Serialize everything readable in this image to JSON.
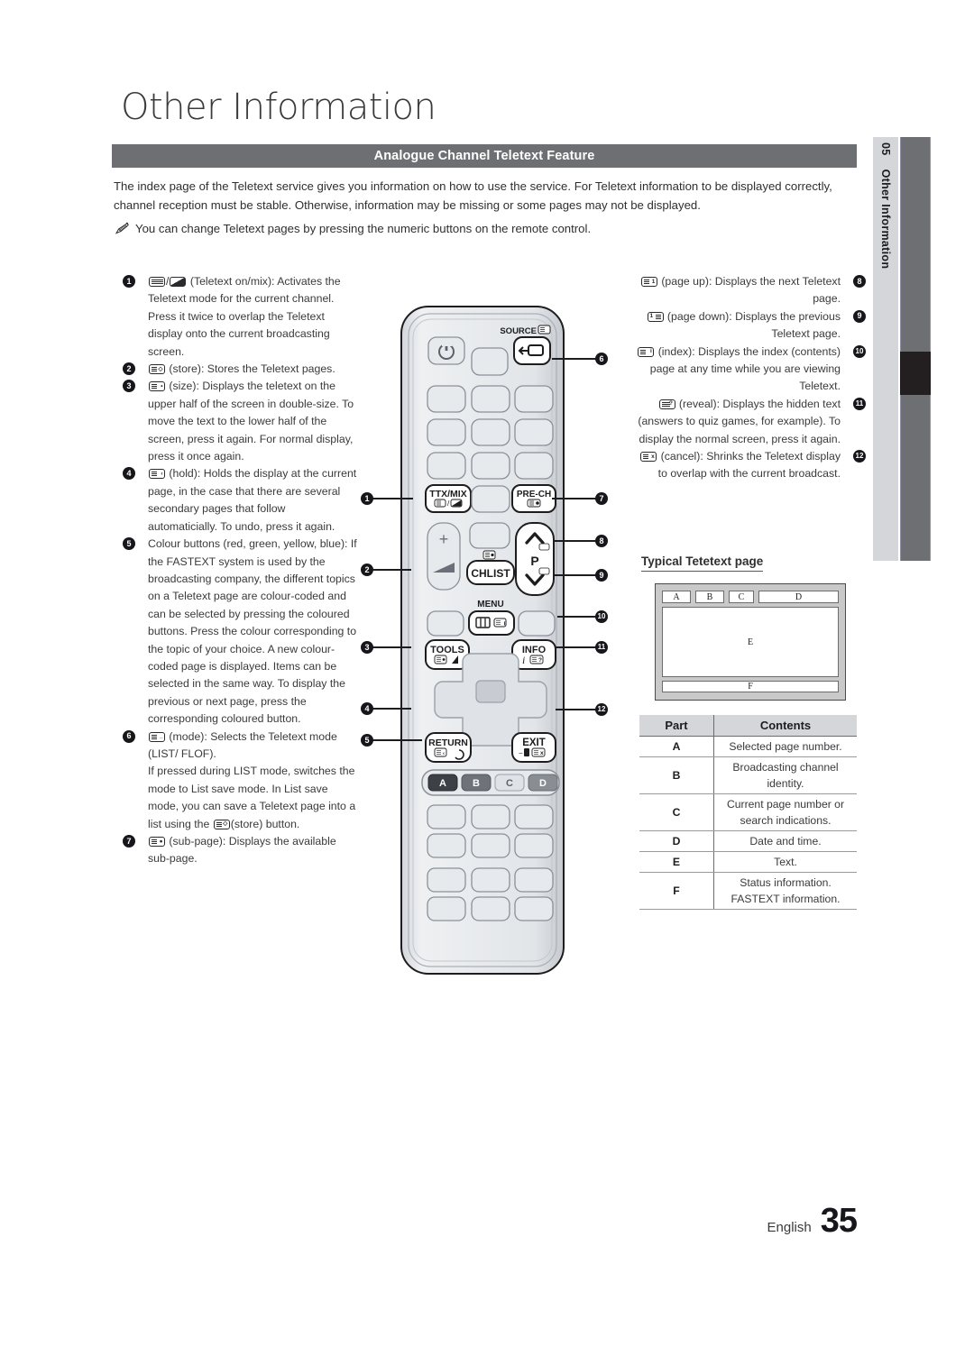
{
  "page_title": "Other Information",
  "section_header": "Analogue Channel Teletext Feature",
  "intro_paragraph": "The index page of the Teletext service gives you information on how to use the service. For Teletext information to be displayed correctly, channel reception must be stable. Otherwise, information may be missing or some pages may not be displayed.",
  "note": "You can change Teletext pages by pressing the numeric buttons on the remote control.",
  "note_icon": "pencil-icon",
  "sidebar": {
    "chapter_number": "05",
    "chapter_title": "Other Information"
  },
  "left_column": [
    {
      "number": "1",
      "icon": "teletext-on-mix-icon",
      "text": "(Teletext on/mix): Activates the Teletext mode for the current channel. Press it twice to overlap the Teletext display onto the current broadcasting screen."
    },
    {
      "number": "2",
      "icon": "teletext-store-icon",
      "text": "(store): Stores the Teletext pages."
    },
    {
      "number": "3",
      "icon": "teletext-size-icon",
      "text": "(size): Displays the teletext on the upper half of the screen in double-size. To move the text to the lower half of the screen, press it again. For normal display, press it once again."
    },
    {
      "number": "4",
      "icon": "teletext-hold-icon",
      "text": "(hold): Holds the display at the current page, in the case that there are several secondary pages that follow automaticially. To undo, press it again."
    },
    {
      "number": "5",
      "icon": "",
      "text": "Colour buttons (red, green, yellow, blue): If the FASTEXT system is used by the broadcasting company, the different topics on a Teletext page are colour-coded and can be selected by pressing the coloured buttons. Press the colour corresponding to the topic of your choice. A new colour-coded page is displayed. Items can be selected in the same way. To display the previous or next page, press the corresponding coloured button."
    },
    {
      "number": "6",
      "icon": "teletext-mode-icon",
      "text": "(mode): Selects the Teletext mode (LIST/ FLOF).",
      "text_extra_a": "If pressed during LIST mode, switches the mode to List save mode. In List save mode, you can save a Teletext page into a list using the ",
      "text_extra_b": "(store) button."
    },
    {
      "number": "7",
      "icon": "teletext-sub-page-icon",
      "text": "(sub-page): Displays the available sub-page."
    }
  ],
  "right_column": [
    {
      "number": "8",
      "icon": "teletext-page-up-icon",
      "text": "(page up): Displays the next Teletext page."
    },
    {
      "number": "9",
      "icon": "teletext-page-down-icon",
      "text": "(page down): Displays the previous Teletext page."
    },
    {
      "number": "10",
      "icon": "teletext-index-icon",
      "text": "(index): Displays the index (contents) page at any time while you are viewing Teletext."
    },
    {
      "number": "11",
      "icon": "teletext-reveal-icon",
      "text": "(reveal): Displays the hidden text (answers to quiz games, for example). To display the normal screen, press it again."
    },
    {
      "number": "12",
      "icon": "teletext-cancel-icon",
      "text": "(cancel): Shrinks the Teletext display to overlap with the current broadcast."
    }
  ],
  "typical_page": {
    "title": "Typical Tetetext page",
    "regions": [
      "A",
      "B",
      "C",
      "D",
      "E",
      "F"
    ]
  },
  "parts_table": {
    "headers": [
      "Part",
      "Contents"
    ],
    "rows": [
      {
        "part": "A",
        "contents": "Selected page number."
      },
      {
        "part": "B",
        "contents": "Broadcasting channel identity."
      },
      {
        "part": "C",
        "contents": "Current page number or search indications."
      },
      {
        "part": "D",
        "contents": "Date and time."
      },
      {
        "part": "E",
        "contents": "Text."
      },
      {
        "part": "F",
        "contents": "Status information. FASTEXT information."
      }
    ]
  },
  "remote": {
    "labels": {
      "source": "SOURCE",
      "ttxmix": "TTX/MIX",
      "prech": "PRE-CH",
      "chlist": "CHLIST",
      "menu": "MENU",
      "tools": "TOOLS",
      "info": "INFO",
      "return": "RETURN",
      "exit": "EXIT",
      "p": "P",
      "plus": "+",
      "colour_a": "A",
      "colour_b": "B",
      "colour_c": "C",
      "colour_d": "D"
    },
    "callouts_left": [
      "1",
      "2",
      "3",
      "4",
      "5"
    ],
    "callouts_right": [
      "6",
      "7",
      "8",
      "9",
      "10",
      "11",
      "12"
    ]
  },
  "footer": {
    "language": "English",
    "page_number": "35"
  },
  "colors": {
    "header_bar": "#6d6f73",
    "sidebar_tab": "#d4d6d9",
    "sidebar_bar": "#6d6f73",
    "sidebar_marker": "#231f20",
    "text": "#3a3a3c"
  }
}
